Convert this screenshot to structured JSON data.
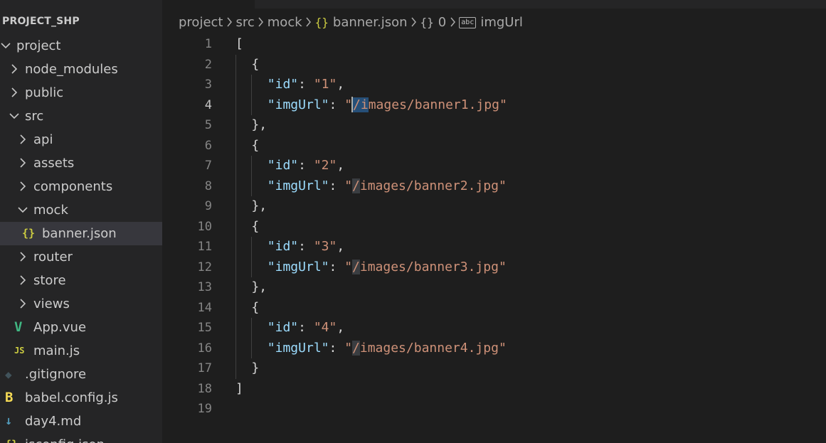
{
  "explorer": {
    "title": "PROJECT_SHP",
    "tree": [
      {
        "label": "project",
        "kind": "folder",
        "expanded": true,
        "depth": 0,
        "icon": ""
      },
      {
        "label": "node_modules",
        "kind": "folder",
        "expanded": false,
        "depth": 1,
        "icon": ""
      },
      {
        "label": "public",
        "kind": "folder",
        "expanded": false,
        "depth": 1,
        "icon": ""
      },
      {
        "label": "src",
        "kind": "folder",
        "expanded": true,
        "depth": 1,
        "icon": ""
      },
      {
        "label": "api",
        "kind": "folder",
        "expanded": false,
        "depth": 2,
        "icon": ""
      },
      {
        "label": "assets",
        "kind": "folder",
        "expanded": false,
        "depth": 2,
        "icon": ""
      },
      {
        "label": "components",
        "kind": "folder",
        "expanded": false,
        "depth": 2,
        "icon": ""
      },
      {
        "label": "mock",
        "kind": "folder",
        "expanded": true,
        "depth": 2,
        "icon": ""
      },
      {
        "label": "banner.json",
        "kind": "file",
        "depth": 3,
        "icon": "{}",
        "selected": true
      },
      {
        "label": "router",
        "kind": "folder",
        "expanded": false,
        "depth": 2,
        "icon": ""
      },
      {
        "label": "store",
        "kind": "folder",
        "expanded": false,
        "depth": 2,
        "icon": ""
      },
      {
        "label": "views",
        "kind": "folder",
        "expanded": false,
        "depth": 2,
        "icon": ""
      },
      {
        "label": "App.vue",
        "kind": "file",
        "depth": 2,
        "icon": "V"
      },
      {
        "label": "main.js",
        "kind": "file",
        "depth": 2,
        "icon": "JS"
      },
      {
        "label": ".gitignore",
        "kind": "file",
        "depth": 1,
        "icon": "◆"
      },
      {
        "label": "babel.config.js",
        "kind": "file",
        "depth": 1,
        "icon": "B"
      },
      {
        "label": "day4.md",
        "kind": "file",
        "depth": 1,
        "icon": "↓"
      },
      {
        "label": "jsconfig.json",
        "kind": "file",
        "depth": 1,
        "icon": "{}"
      }
    ]
  },
  "breadcrumb": [
    {
      "label": "project",
      "icon": ""
    },
    {
      "label": "src",
      "icon": ""
    },
    {
      "label": "mock",
      "icon": ""
    },
    {
      "label": "banner.json",
      "icon": "{}"
    },
    {
      "label": "0",
      "icon": "{}"
    },
    {
      "label": "imgUrl",
      "icon": "abc"
    }
  ],
  "editor": {
    "active_line": 4,
    "line_numbers": [
      "1",
      "2",
      "3",
      "4",
      "5",
      "6",
      "7",
      "8",
      "9",
      "10",
      "11",
      "12",
      "13",
      "14",
      "15",
      "16",
      "17",
      "18",
      "19"
    ],
    "lines": [
      {
        "indent": 0,
        "text": "["
      },
      {
        "indent": 1,
        "text": "{"
      },
      {
        "indent": 2,
        "key": "\"id\"",
        "value": "\"1\"",
        "trail": ","
      },
      {
        "indent": 2,
        "key": "\"imgUrl\"",
        "value": "\"/images/banner1.jpg\"",
        "trail": ""
      },
      {
        "indent": 1,
        "text": "},"
      },
      {
        "indent": 1,
        "text": "{"
      },
      {
        "indent": 2,
        "key": "\"id\"",
        "value": "\"2\"",
        "trail": ","
      },
      {
        "indent": 2,
        "key": "\"imgUrl\"",
        "value": "\"/images/banner2.jpg\"",
        "trail": ""
      },
      {
        "indent": 1,
        "text": "},"
      },
      {
        "indent": 1,
        "text": "{"
      },
      {
        "indent": 2,
        "key": "\"id\"",
        "value": "\"3\"",
        "trail": ","
      },
      {
        "indent": 2,
        "key": "\"imgUrl\"",
        "value": "\"/images/banner3.jpg\"",
        "trail": ""
      },
      {
        "indent": 1,
        "text": "},"
      },
      {
        "indent": 1,
        "text": "{"
      },
      {
        "indent": 2,
        "key": "\"id\"",
        "value": "\"4\"",
        "trail": ","
      },
      {
        "indent": 2,
        "key": "\"imgUrl\"",
        "value": "\"/images/banner4.jpg\"",
        "trail": ""
      },
      {
        "indent": 1,
        "text": "}"
      },
      {
        "indent": 0,
        "text": "]"
      },
      {
        "indent": 0,
        "text": ""
      }
    ]
  },
  "colors": {
    "json_key": "#9cdcfe",
    "json_string": "#ce9178",
    "json_file_icon": "#cbcb41",
    "vue_icon": "#41b883",
    "js_icon": "#cbcb41",
    "git_icon": "#41535b",
    "babel_icon": "#f5da55",
    "md_icon": "#519aba"
  }
}
